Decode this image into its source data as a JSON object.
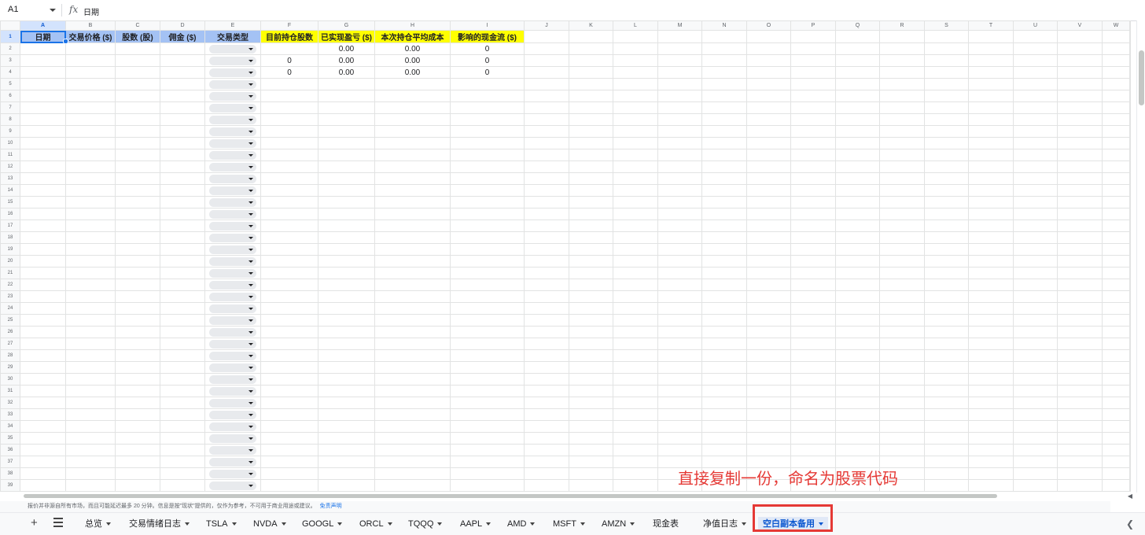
{
  "formula_bar": {
    "cell_ref": "A1",
    "fx_icon": "fx-icon",
    "content": "日期"
  },
  "columns": [
    "A",
    "B",
    "C",
    "D",
    "E",
    "F",
    "G",
    "H",
    "I",
    "J",
    "K",
    "L",
    "M",
    "N",
    "O",
    "P",
    "Q",
    "R",
    "S",
    "T",
    "U",
    "V",
    "W"
  ],
  "header_row": {
    "A": "日期",
    "B": "交易价格 ($)",
    "C": "股数 (股)",
    "D": "佣金 ($)",
    "E": "交易类型",
    "F": "目前持仓股数",
    "G": "已实现盈亏 ($)",
    "H": "本次持仓平均成本",
    "I": "影响的现金流 ($)"
  },
  "data_rows": [
    {
      "F": "",
      "G": "0.00",
      "H": "0.00",
      "I": "0"
    },
    {
      "F": "0",
      "G": "0.00",
      "H": "0.00",
      "I": "0"
    },
    {
      "F": "0",
      "G": "0.00",
      "H": "0.00",
      "I": "0"
    }
  ],
  "row_count": 39,
  "disclaimer": {
    "text": "报价并非源自所有市场，而且可能延迟最多 20 分钟。信息是按\"现状\"提供的，仅作为参考，不可用于商业用途或建议。",
    "link": "免责声明"
  },
  "annotation": "直接复制一份，命名为股票代码",
  "sheet_tabs": [
    {
      "label": "总览"
    },
    {
      "label": "交易情绪日志"
    },
    {
      "label": "TSLA"
    },
    {
      "label": "NVDA"
    },
    {
      "label": "GOOGL"
    },
    {
      "label": "ORCL"
    },
    {
      "label": "TQQQ"
    },
    {
      "label": "AAPL"
    },
    {
      "label": "AMD"
    },
    {
      "label": "MSFT"
    },
    {
      "label": "AMZN"
    },
    {
      "label": "现金表"
    },
    {
      "label": "净值日志"
    },
    {
      "label": "空白副本备用"
    }
  ],
  "active_tab": "空白副本备用",
  "colors": {
    "header_blue": "#a4c2f4",
    "header_yellow": "#ffff00",
    "annotation_red": "#e53935",
    "accent": "#1a73e8"
  }
}
